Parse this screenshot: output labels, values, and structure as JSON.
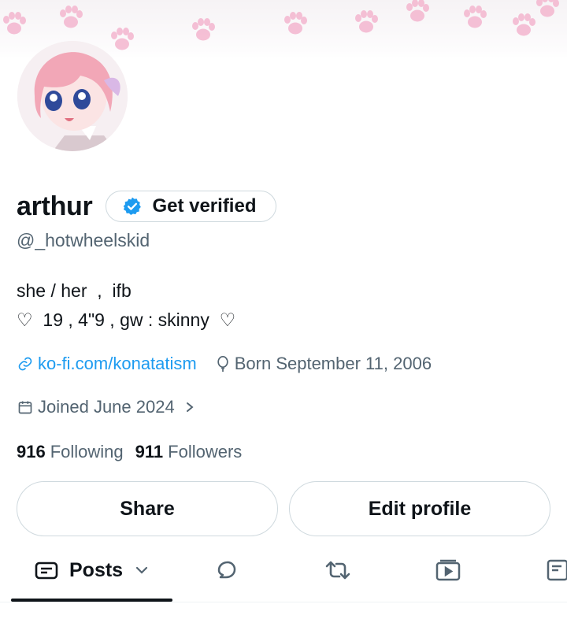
{
  "profile": {
    "name": "arthur",
    "handle": "@_hotwheelskid",
    "verify_label": "Get verified",
    "bio_line1": "she / her  ,  ifb",
    "bio_line2": "♡  19 , 4\"9 , gw : skinny  ♡",
    "link": "ko-fi.com/konatatism",
    "birth": "Born September 11, 2006",
    "joined": "Joined June 2024",
    "following_count": "916",
    "following_label": "Following",
    "followers_count": "911",
    "followers_label": "Followers"
  },
  "buttons": {
    "share": "Share",
    "edit_profile": "Edit profile"
  },
  "tabs": {
    "posts": "Posts"
  },
  "colors": {
    "link": "#1d9bf0",
    "muted": "#536471",
    "verify_badge": "#1d9bf0",
    "paw": "#f4b6cf"
  },
  "icons": [
    "paw-icon",
    "verified-badge-icon",
    "link-icon",
    "birth-balloon-icon",
    "calendar-icon",
    "chevron-right-icon",
    "posts-icon",
    "chevron-down-icon",
    "replies-icon",
    "reposts-icon",
    "media-icon",
    "articles-icon"
  ]
}
